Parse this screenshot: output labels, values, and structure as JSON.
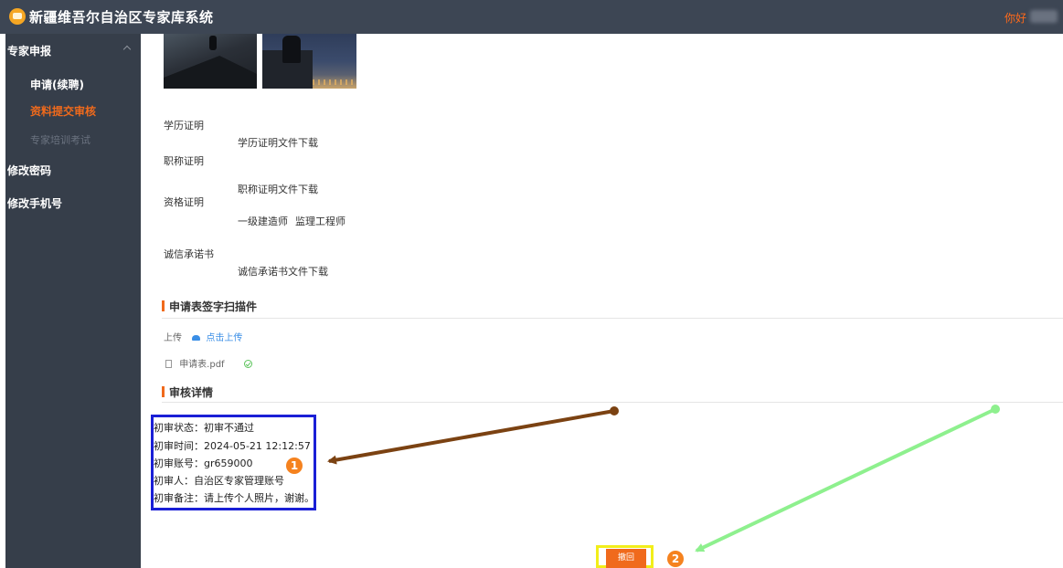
{
  "header": {
    "title": "新疆维吾尔自治区专家库系统",
    "greeting": "你好"
  },
  "sidebar": {
    "group1": "专家申报",
    "sub_items": [
      "申请(续聘)",
      "资料提交审核",
      "专家培训考试"
    ],
    "item2": "修改密码",
    "item3": "修改手机号"
  },
  "colors": {
    "header_bg": "#3d4654",
    "sidebar_bg": "#363e4a",
    "accent": "#f06a1c",
    "sub_active": "#f06a1c",
    "sub_normal": "#ffffff",
    "sub_disabled": "#6b7380"
  },
  "certs": {
    "education_label": "学历证明",
    "education_link": "学历证明文件下载",
    "title_label": "职称证明",
    "title_link": "职称证明文件下载",
    "qualification_label": "资格证明",
    "qualification_value_1": "一级建造师",
    "qualification_value_2": "监理工程师",
    "integrity_label": "诚信承诺书",
    "integrity_link": "诚信承诺书文件下载"
  },
  "scan_section": {
    "title": "申请表签字扫描件",
    "upload_label": "上传",
    "upload_link": "点击上传",
    "file_name": "申请表.pdf"
  },
  "review_section": {
    "title": "审核详情",
    "lines": [
      "初审状态：初审不通过",
      "初审时间：2024-05-21 12:12:57",
      "初审账号：gr659000",
      "初审人：自治区专家管理账号",
      "初审备注：请上传个人照片，谢谢。"
    ]
  },
  "withdraw_button": "撤回",
  "annotations": {
    "badge1": "1",
    "badge2": "2",
    "arrow1_color": "#7b4212",
    "arrow2_color": "#8ef08e",
    "box1_color": "#1a1fd6",
    "box2_color": "#f2ee1a"
  }
}
